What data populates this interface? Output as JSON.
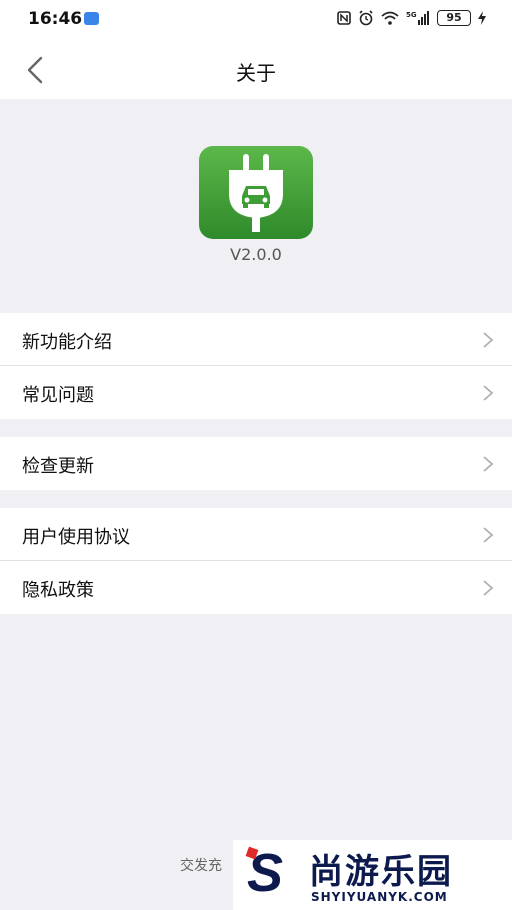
{
  "status_bar": {
    "time": "16:46",
    "battery": "95"
  },
  "nav": {
    "title": "关于"
  },
  "app": {
    "version": "V2.0.0"
  },
  "groups": [
    {
      "items": [
        {
          "label": "新功能介绍"
        },
        {
          "label": "常见问题"
        }
      ]
    },
    {
      "items": [
        {
          "label": "检查更新"
        }
      ]
    },
    {
      "items": [
        {
          "label": "用户使用协议"
        },
        {
          "label": "隐私政策"
        }
      ]
    }
  ],
  "footer": {
    "text": "交发充"
  },
  "watermark": {
    "brand_cn": "尚游乐园",
    "brand_en": "SHYIYUANYK.COM"
  },
  "colors": {
    "logo_green": "#3f9d36",
    "background": "#efeff4"
  }
}
